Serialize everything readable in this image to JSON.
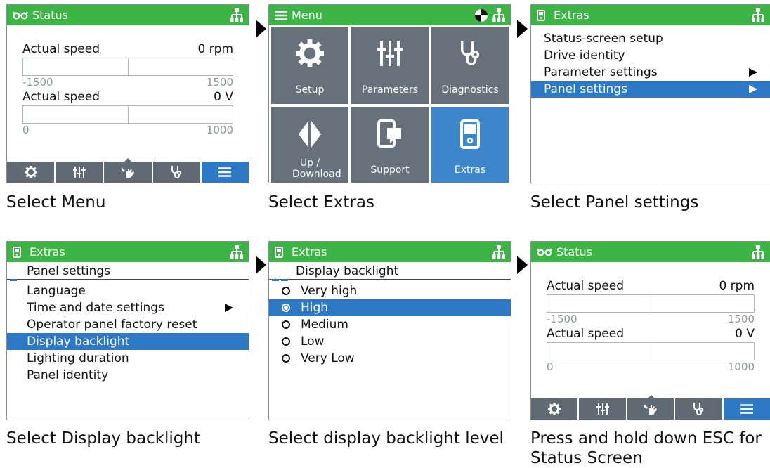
{
  "colors": {
    "header_green": "#3cb446",
    "selection_blue": "#2e79c6",
    "tile_gray": "#66717b",
    "tabbar_gray": "#5f6a74"
  },
  "status": {
    "title": "Status",
    "rows": [
      {
        "label": "Actual speed",
        "value": "0 rpm",
        "scale_min": "-1500",
        "scale_max": "1500"
      },
      {
        "label": "Actual speed",
        "value": "0 V",
        "scale_min": "0",
        "scale_max": "1000"
      }
    ],
    "tabs": [
      "gear-icon",
      "sliders-icon",
      "hand-wrench-icon",
      "stethoscope-icon",
      "menu-icon"
    ],
    "active_tab": "menu-icon"
  },
  "menu": {
    "title": "Menu",
    "tiles": [
      {
        "label": "Setup",
        "icon": "gear-icon"
      },
      {
        "label": "Parameters",
        "icon": "sliders-icon"
      },
      {
        "label": "Diagnostics",
        "icon": "stethoscope-icon"
      },
      {
        "label": "Up / Download",
        "icon": "transfer-icon"
      },
      {
        "label": "Support",
        "icon": "support-icon"
      },
      {
        "label": "Extras",
        "icon": "extras-icon"
      }
    ],
    "active_tile": "Extras"
  },
  "extras": {
    "title": "Extras",
    "items": [
      "Status-screen setup",
      "Drive identity",
      "Parameter settings",
      "Panel settings"
    ],
    "selected": "Panel settings"
  },
  "panel_settings": {
    "title": "Extras",
    "subheader": "Panel settings",
    "items": [
      "Language",
      "Time and date settings",
      "Operator panel factory reset",
      "Display backlight",
      "Lighting duration",
      "Panel identity"
    ],
    "selected": "Display backlight"
  },
  "backlight": {
    "title": "Extras",
    "subheader": "Display backlight",
    "options": [
      "Very high",
      "High",
      "Medium",
      "Low",
      "Very Low"
    ],
    "selected": "High"
  },
  "captions": {
    "c1": "Select Menu",
    "c2": "Select Extras",
    "c3": "Select Panel settings",
    "c4": "Select Display backlight",
    "c5": "Select display backlight level",
    "c6_line1": "Press and hold down ESC for",
    "c6_line2": "Status Screen"
  }
}
